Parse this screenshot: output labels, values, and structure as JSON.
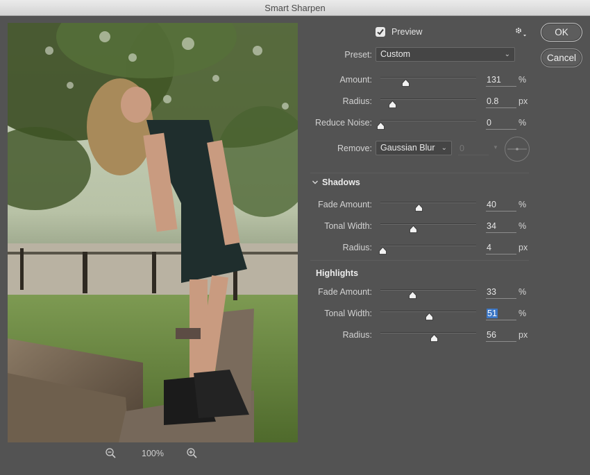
{
  "window": {
    "title": "Smart Sharpen"
  },
  "preview": {
    "label": "Preview",
    "checked": true
  },
  "zoom": {
    "level": "100%"
  },
  "buttons": {
    "ok": "OK",
    "cancel": "Cancel"
  },
  "preset": {
    "label": "Preset:",
    "value": "Custom"
  },
  "main": {
    "amount": {
      "label": "Amount:",
      "value": "131",
      "unit": "%",
      "level": 0.26
    },
    "radius": {
      "label": "Radius:",
      "value": "0.8",
      "unit": "px",
      "level": 0.12
    },
    "reduce_noise": {
      "label": "Reduce Noise:",
      "value": "0",
      "unit": "%",
      "level": 0.0
    }
  },
  "remove": {
    "label": "Remove:",
    "value": "Gaussian Blur",
    "angle": "0"
  },
  "shadows": {
    "title": "Shadows",
    "fade_amount": {
      "label": "Fade Amount:",
      "value": "40",
      "unit": "%",
      "level": 0.4
    },
    "tonal_width": {
      "label": "Tonal Width:",
      "value": "34",
      "unit": "%",
      "level": 0.34
    },
    "radius": {
      "label": "Radius:",
      "value": "4",
      "unit": "px",
      "level": 0.02
    }
  },
  "highlights": {
    "title": "Highlights",
    "fade_amount": {
      "label": "Fade Amount:",
      "value": "33",
      "unit": "%",
      "level": 0.33
    },
    "tonal_width": {
      "label": "Tonal Width:",
      "value": "51",
      "unit": "%",
      "level": 0.51,
      "selected": true
    },
    "radius": {
      "label": "Radius:",
      "value": "56",
      "unit": "px",
      "level": 0.56
    }
  },
  "colors": {
    "panel": "#535353",
    "selection": "#3b76c5",
    "text": "#d6d6d6"
  }
}
